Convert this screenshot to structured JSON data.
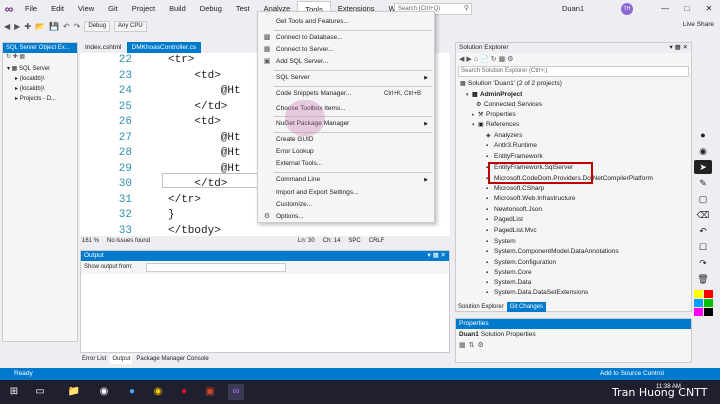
{
  "menubar": {
    "items": [
      "File",
      "Edit",
      "View",
      "Git",
      "Project",
      "Build",
      "Debug",
      "Test",
      "Analyze",
      "Tools",
      "Extensions",
      "Window",
      "Help"
    ],
    "search_placeholder": "Search (Ctrl+Q)",
    "solution_name": "Duan1",
    "avatar_initials": "TH"
  },
  "toolbar": {
    "config": "Debug",
    "platform": "Any CPU",
    "live_share": "Live Share"
  },
  "left_panel": {
    "title": "SQL Server Object Ex...",
    "tree": [
      "SQL Server",
      "(localdb)\\",
      "(localdb)\\",
      "Projects - D..."
    ]
  },
  "tabs": [
    "Index.cshtml",
    "DMKhoasController.cs"
  ],
  "editor": {
    "lines": [
      {
        "n": "22",
        "code": "<tr>"
      },
      {
        "n": "23",
        "code": "    <td>"
      },
      {
        "n": "24",
        "code": "        @Ht"
      },
      {
        "n": "25",
        "code": "    </td>"
      },
      {
        "n": "26",
        "code": "    <td>"
      },
      {
        "n": "27",
        "code": "        @Ht"
      },
      {
        "n": "28",
        "code": "        @Ht"
      },
      {
        "n": "29",
        "code": "        @Ht"
      },
      {
        "n": "30",
        "code": "    </td>"
      },
      {
        "n": "31",
        "code": "</tr>"
      },
      {
        "n": "32",
        "code": "}"
      },
      {
        "n": "33",
        "code": "</tbody>"
      }
    ],
    "status": {
      "zoom": "161 %",
      "issues": "No issues found",
      "ln": "Ln: 30",
      "ch": "Ch: 14",
      "spc": "SPC",
      "crlf": "CRLF"
    }
  },
  "tools_menu": {
    "items": [
      {
        "label": "Get Tools and Features...",
        "shortcut": "",
        "submenu": false
      },
      {
        "label": "Connect to Database...",
        "shortcut": "",
        "submenu": false
      },
      {
        "label": "Connect to Server...",
        "shortcut": "",
        "submenu": false
      },
      {
        "label": "Add SQL Server...",
        "shortcut": "",
        "submenu": false
      },
      {
        "label": "SQL Server",
        "shortcut": "",
        "submenu": true
      },
      {
        "label": "Code Snippets Manager...",
        "shortcut": "Ctrl+K, Ctrl+B",
        "submenu": false
      },
      {
        "label": "Choose Toolbox Items...",
        "shortcut": "",
        "submenu": false
      },
      {
        "label": "NuGet Package Manager",
        "shortcut": "",
        "submenu": true
      },
      {
        "label": "Create GUID",
        "shortcut": "",
        "submenu": false
      },
      {
        "label": "Error Lookup",
        "shortcut": "",
        "submenu": false
      },
      {
        "label": "External Tools...",
        "shortcut": "",
        "submenu": false
      },
      {
        "label": "Command Line",
        "shortcut": "",
        "submenu": true
      },
      {
        "label": "Import and Export Settings...",
        "shortcut": "",
        "submenu": false
      },
      {
        "label": "Customize...",
        "shortcut": "",
        "submenu": false
      },
      {
        "label": "Options...",
        "shortcut": "",
        "submenu": false
      }
    ]
  },
  "output": {
    "title": "Output",
    "show_from": "Show output from:",
    "tabs": [
      "Error List",
      "Output",
      "Package Manager Console"
    ]
  },
  "solution_explorer": {
    "title": "Solution Explorer",
    "search_placeholder": "Search Solution Explorer (Ctrl+;)",
    "rows": [
      "Solution 'Duan1' (2 of 2 projects)",
      "AdminProject",
      "Connected Services",
      "Properties",
      "References",
      "Analyzers",
      "Antlr3.Runtime",
      "EntityFramework",
      "EntityFramework.SqlServer",
      "Microsoft.CodeDom.Providers.DotNetCompilerPlatform",
      "Microsoft.CSharp",
      "Microsoft.Web.Infrastructure",
      "Newtonsoft.Json",
      "PagedList",
      "PagedList.Mvc",
      "System",
      "System.ComponentModel.DataAnnotations",
      "System.Configuration",
      "System.Core",
      "System.Data",
      "System.Data.DataSetExtensions"
    ],
    "bottom_tabs": [
      "Solution Explorer",
      "Git Changes"
    ]
  },
  "properties": {
    "title": "Properties",
    "object_name": "Duan1",
    "object_type": "Solution Properties"
  },
  "statusbar": {
    "left": "Ready",
    "right": "Add to Source Control"
  },
  "taskbar": {
    "time": "11:38 AM",
    "watermark": "Tran Huong CNTT"
  },
  "colors": {
    "accent": "#007acc",
    "highlight_red": "#c00000",
    "vs_purple": "#68217a"
  }
}
